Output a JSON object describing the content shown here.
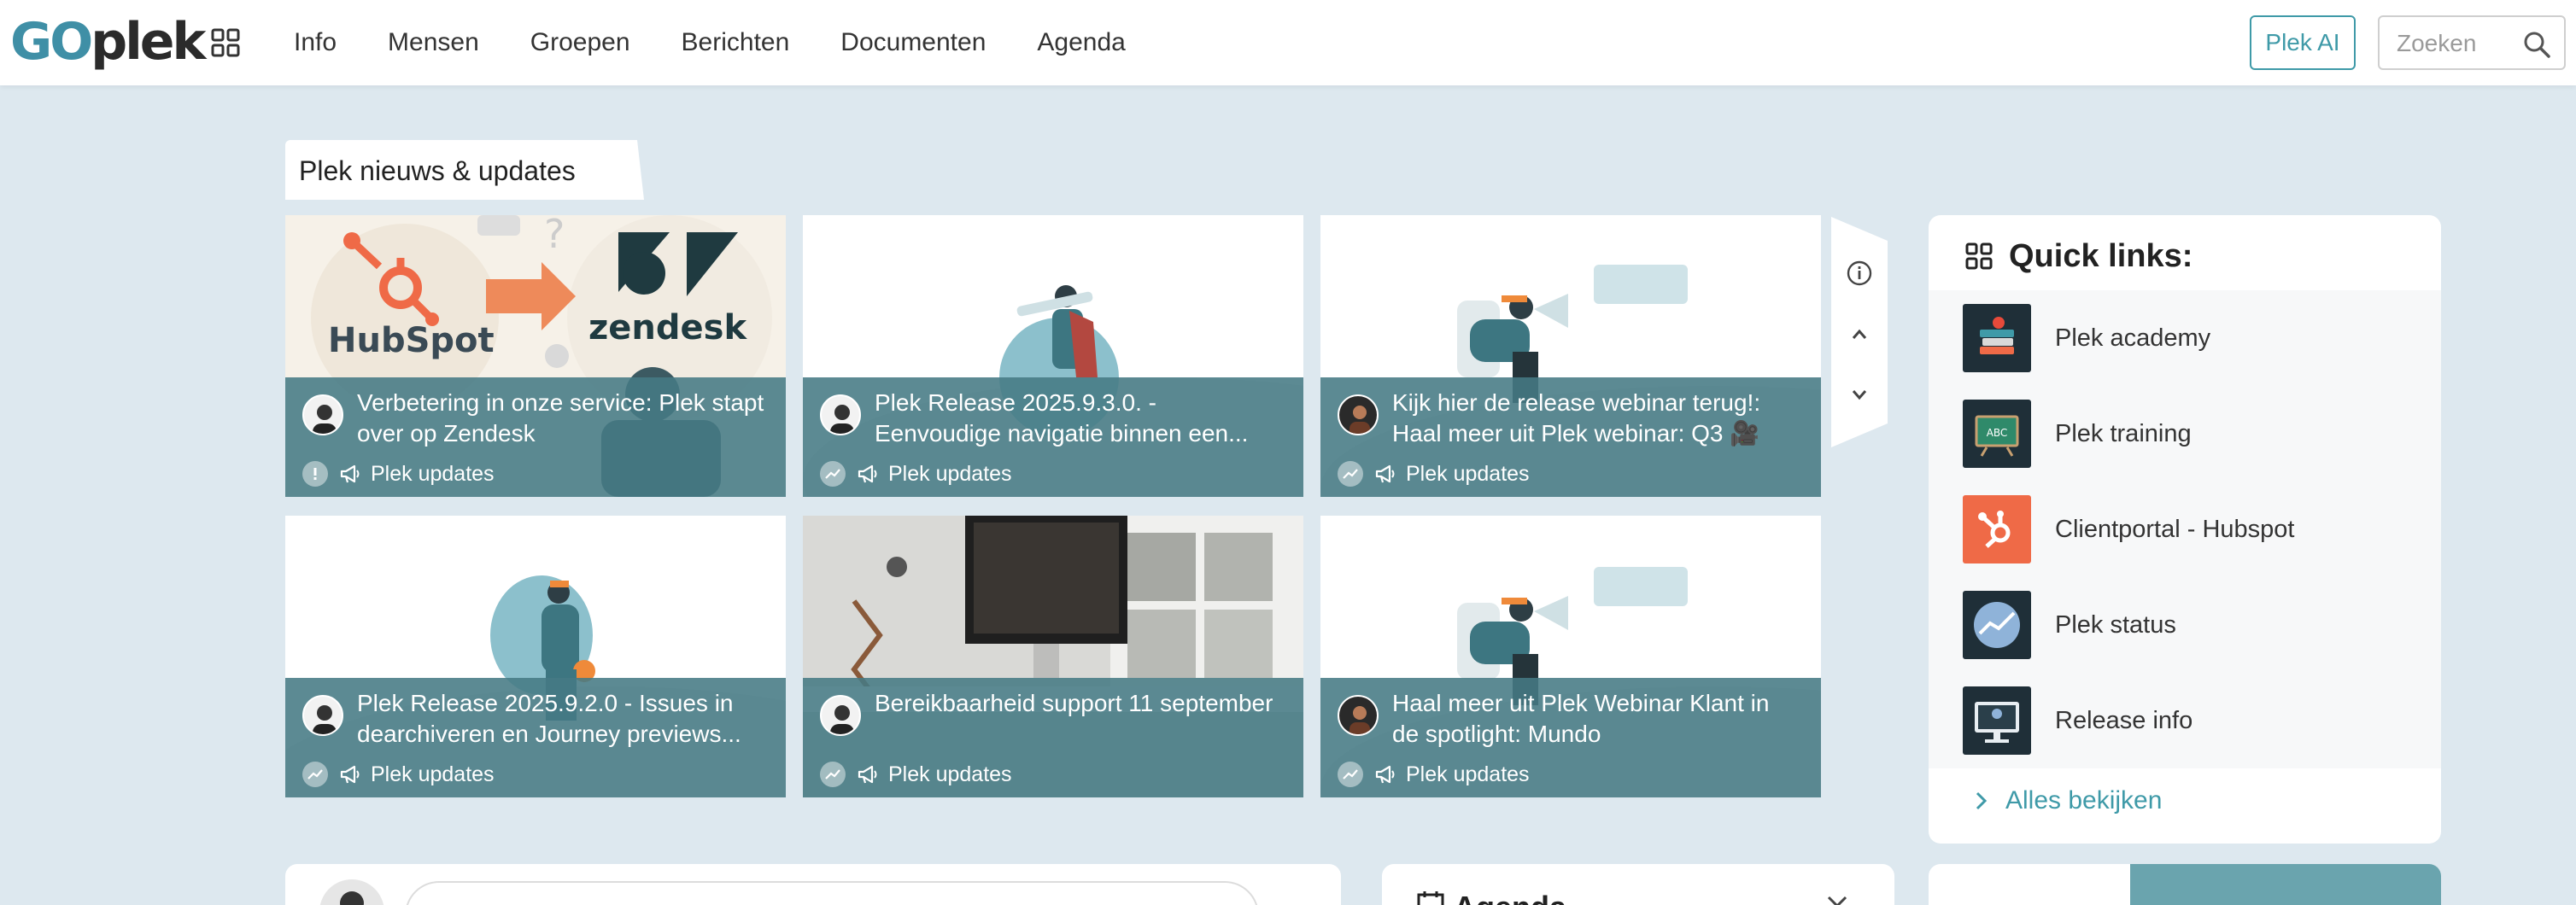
{
  "header": {
    "logo_go": "GO",
    "logo_plek": "plek",
    "nav": [
      "Info",
      "Mensen",
      "Groepen",
      "Berichten",
      "Documenten",
      "Agenda"
    ],
    "ai_button": "Plek AI",
    "search_placeholder": "Zoeken"
  },
  "news": {
    "section_title": "Plek nieuws & updates",
    "cards": [
      {
        "title": "Verbetering in onze service: Plek stapt over op Zendesk",
        "category": "Plek updates",
        "status_icon": "exclamation-icon",
        "illustration": "hubspot-to-zendesk"
      },
      {
        "title": "Plek Release 2025.9.3.0. - Eenvoudige navigatie binnen een...",
        "category": "Plek updates",
        "status_icon": "trend-icon",
        "illustration": "person-with-telescope"
      },
      {
        "title": "Kijk hier de release webinar terug!: Haal meer uit Plek webinar: Q3 🎥",
        "category": "Plek updates",
        "status_icon": "trend-icon",
        "illustration": "person-with-megaphone"
      },
      {
        "title": "Plek Release 2025.9.2.0 - Issues in dearchiveren en Journey previews...",
        "category": "Plek updates",
        "status_icon": "trend-icon",
        "illustration": "person-with-ball"
      },
      {
        "title": "Bereikbaarheid support 11 september",
        "category": "Plek updates",
        "status_icon": "trend-icon",
        "illustration": "office-photo"
      },
      {
        "title": "Haal meer uit Plek Webinar Klant in de spotlight: Mundo",
        "category": "Plek updates",
        "status_icon": "trend-icon",
        "illustration": "person-with-megaphone"
      }
    ],
    "hubspot_text": "HubSpot",
    "zendesk_text": "zendesk"
  },
  "quick_links": {
    "title": "Quick links:",
    "items": [
      {
        "label": "Plek academy",
        "thumb": "books-thumb",
        "color": "#1f2f38"
      },
      {
        "label": "Plek training",
        "thumb": "chalkboard-thumb",
        "color": "#1f2f38",
        "thumb_text": "ABC"
      },
      {
        "label": "Clientportal - Hubspot",
        "thumb": "hubspot-thumb",
        "color": "#ef6a47"
      },
      {
        "label": "Plek status",
        "thumb": "status-thumb",
        "color": "#1f2f38"
      },
      {
        "label": "Release info",
        "thumb": "monitor-thumb",
        "color": "#1f2f38"
      }
    ],
    "more": "Alles bekijken"
  },
  "bottom": {
    "agenda_title": "Agenda"
  },
  "colors": {
    "accent": "#3f9aa8",
    "overlay": "#467a84",
    "background": "#dde8ef"
  }
}
